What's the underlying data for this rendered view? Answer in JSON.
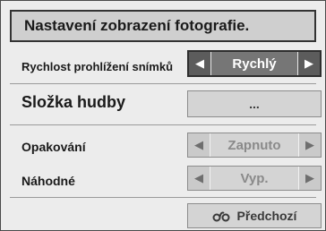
{
  "dialog": {
    "title": "Nastavení zobrazení fotografie.",
    "slide_speed": {
      "label": "Rychlost prohlížení snímků",
      "value": "Rychlý",
      "left_arrow": "◀",
      "right_arrow": "▶"
    },
    "music_folder": {
      "label": "Složka hudby",
      "button": "..."
    },
    "repeat": {
      "label": "Opakování",
      "value": "Zapnuto",
      "left_arrow": "◀",
      "right_arrow": "▶"
    },
    "shuffle": {
      "label": "Náhodné",
      "value": "Vyp.",
      "left_arrow": "◀",
      "right_arrow": "▶"
    },
    "back_button": {
      "label": "Předchozí",
      "icon": "back-arrow-icon"
    }
  },
  "colors": {
    "background": "#ececec",
    "title_bar": "#cfcfcf",
    "active_selector": "#6d6d6d",
    "inactive_selector": "#d0d0d0"
  }
}
